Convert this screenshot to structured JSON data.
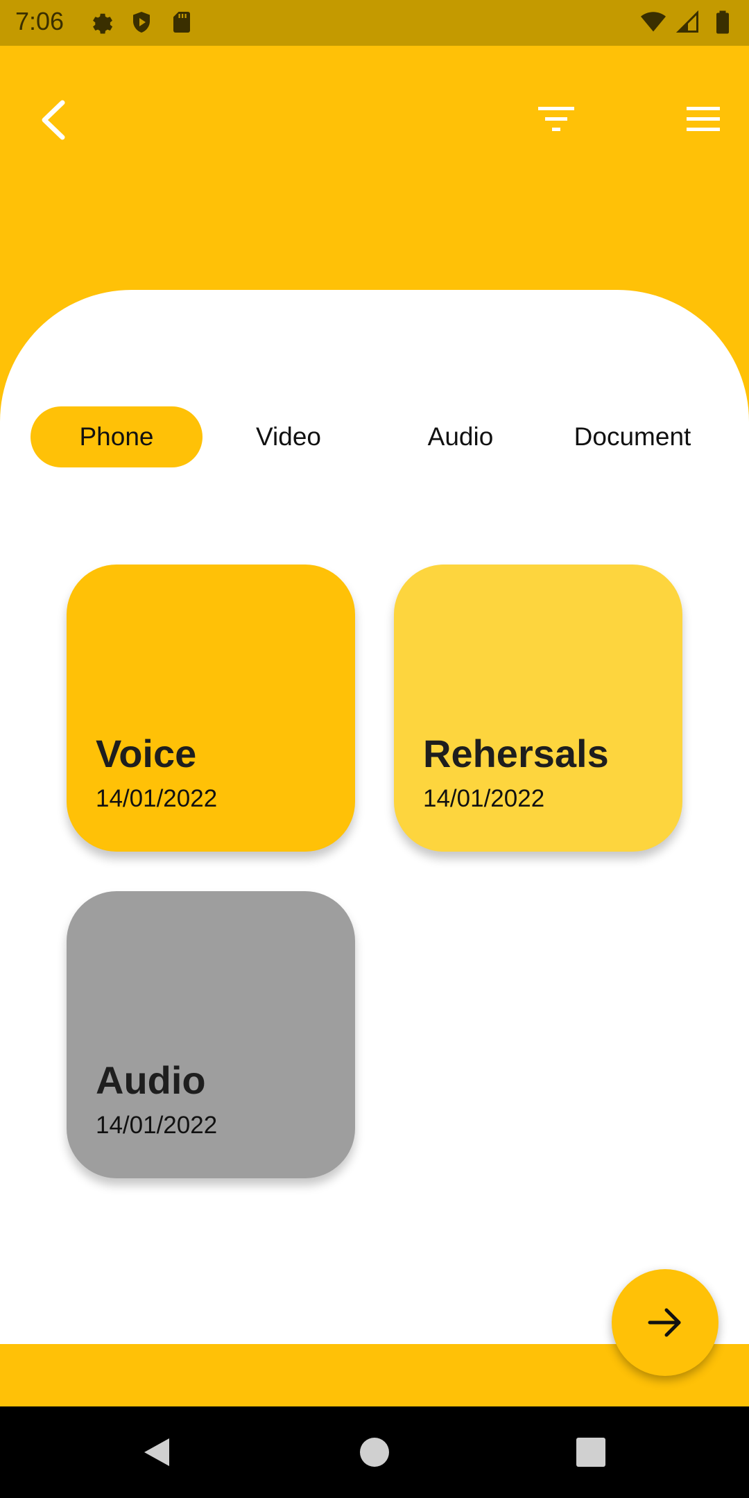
{
  "status_bar": {
    "time": "7:06",
    "left_icons": [
      "gear-icon",
      "shield-play-icon",
      "sd-card-icon"
    ],
    "right_icons": [
      "wifi-icon",
      "signal-icon",
      "battery-icon"
    ]
  },
  "header": {
    "back_icon": "chevron-left-icon",
    "filter_icon": "filter-icon",
    "menu_icon": "hamburger-menu-icon"
  },
  "tabs": [
    {
      "label": "Phone",
      "active": true
    },
    {
      "label": "Video",
      "active": false
    },
    {
      "label": "Audio",
      "active": false
    },
    {
      "label": "Document",
      "active": false
    }
  ],
  "cards": [
    {
      "title": "Voice",
      "date": "14/01/2022",
      "color": "#ffc107"
    },
    {
      "title": "Rehersals",
      "date": "14/01/2022",
      "color": "#fdd53e"
    },
    {
      "title": "Audio",
      "date": "14/01/2022",
      "color": "#9e9e9e"
    }
  ],
  "fab": {
    "icon": "arrow-right-icon"
  },
  "nav": [
    "back-triangle-icon",
    "home-circle-icon",
    "recents-square-icon"
  ],
  "colors": {
    "accent": "#ffc107",
    "status_bar": "#c49a00"
  }
}
